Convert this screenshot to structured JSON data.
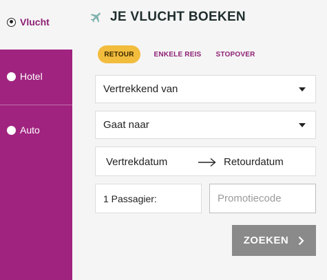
{
  "sidebar": {
    "items": [
      {
        "label": "Vlucht",
        "selected": true,
        "icon": "radio-checked-icon"
      },
      {
        "label": "Hotel",
        "selected": false,
        "icon": "radio-empty-icon"
      },
      {
        "label": "Auto",
        "selected": false,
        "icon": "radio-empty-icon"
      }
    ]
  },
  "header": {
    "title": "JE VLUCHT BOEKEN",
    "icon": "airplane-icon"
  },
  "tabs": [
    {
      "label": "RETOUR",
      "active": true
    },
    {
      "label": "ENKELE REIS",
      "active": false
    },
    {
      "label": "STOPOVER",
      "active": false
    }
  ],
  "form": {
    "departure": {
      "value": "Vertrekkend van",
      "icon": "chevron-down-icon"
    },
    "destination": {
      "value": "Gaat naar",
      "icon": "chevron-down-icon"
    },
    "dates": {
      "departure_label": "Vertrekdatum",
      "return_label": "Retourdatum",
      "icon": "arrow-right-icon"
    },
    "passengers": {
      "value": "1 Passagier:"
    },
    "promo": {
      "placeholder": "Promotiecode",
      "value": ""
    }
  },
  "search_button": {
    "label": "ZOEKEN",
    "icon": "chevron-right-icon"
  },
  "colors": {
    "accent_purple": "#a0237f",
    "tab_active": "#f2bc3d",
    "button_gray": "#8a8a8a",
    "plane_icon": "#7fb3ad",
    "background": "#f5f5f5"
  }
}
